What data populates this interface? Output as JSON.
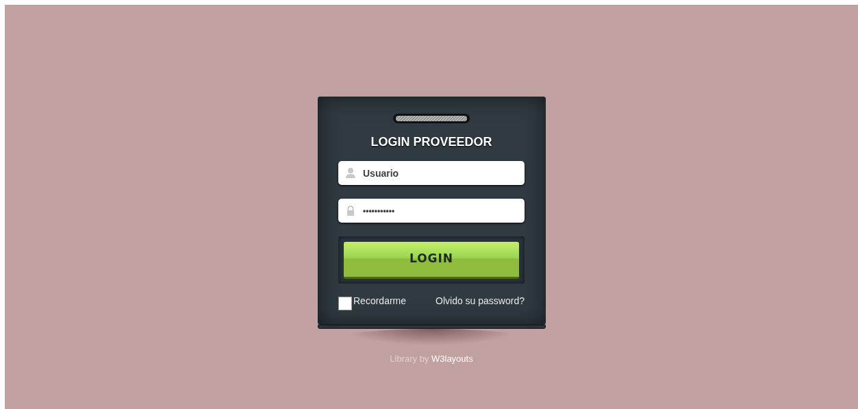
{
  "login_card": {
    "title": "LOGIN PROVEEDOR",
    "username_field": {
      "value": "Usuario"
    },
    "password_field": {
      "value": "•••••••••••"
    },
    "login_button": "LOGIN",
    "remember_me": {
      "label": "Recordarme",
      "checked": false
    },
    "forgot_link": "Olvido su password?"
  },
  "footer": {
    "text": "Library by ",
    "link": "W3layouts"
  }
}
